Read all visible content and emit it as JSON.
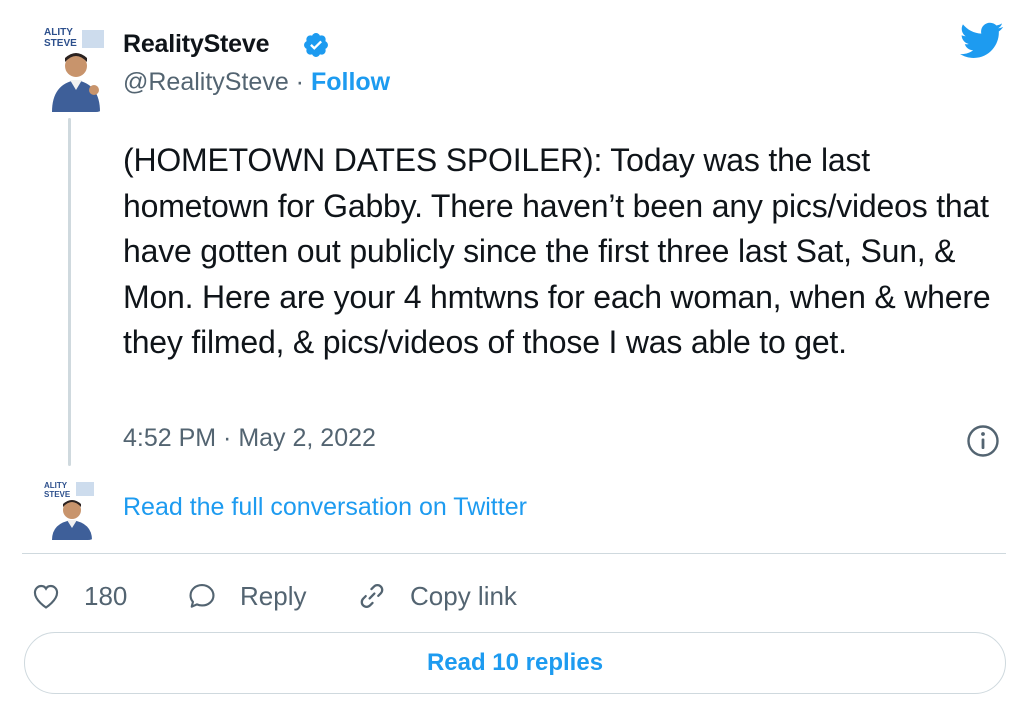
{
  "tweet": {
    "author_name": "RealitySteve",
    "handle": "@RealitySteve",
    "separator": " · ",
    "follow_label": "Follow",
    "text": "(HOMETOWN DATES SPOILER): Today was the last hometown for Gabby. There haven’t been any pics/videos that have gotten out publicly since the first three last Sat, Sun, & Mon. Here are your 4 hmtwns for each woman, when & where they filmed, & pics/videos of those I was able to get.",
    "timestamp": "4:52 PM · May 2, 2022"
  },
  "conversation": {
    "link_text": "Read the full conversation on Twitter"
  },
  "actions": {
    "like_count": "180",
    "reply_label": "Reply",
    "copy_label": "Copy link"
  },
  "replies_button": {
    "label": "Read 10 replies"
  },
  "avatar_text": {
    "line1": "ALITY",
    "line2": "STEVE"
  },
  "colors": {
    "accent": "#1d9bf0",
    "secondary_text": "#536471",
    "border": "#cfd9de"
  },
  "icons": [
    "verified-icon",
    "twitter-bird-icon",
    "info-icon",
    "heart-icon",
    "reply-bubble-icon",
    "link-icon"
  ]
}
